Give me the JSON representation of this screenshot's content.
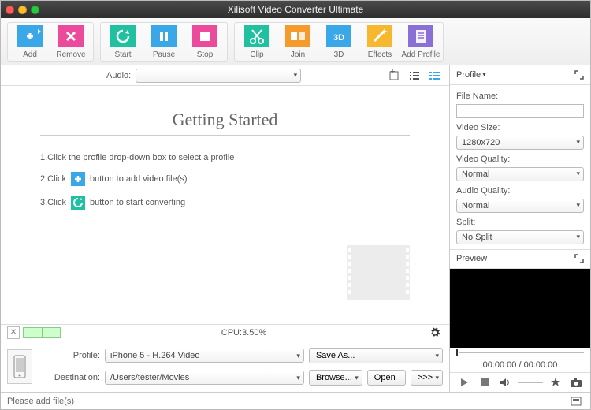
{
  "window": {
    "title": "Xilisoft Video Converter Ultimate"
  },
  "toolbar": {
    "add": "Add",
    "remove": "Remove",
    "start": "Start",
    "pause": "Pause",
    "stop": "Stop",
    "clip": "Clip",
    "join": "Join",
    "threeD": "3D",
    "effects": "Effects",
    "addProfile": "Add Profile"
  },
  "audiobar": {
    "label": "Audio:"
  },
  "getting_started": {
    "title": "Getting Started",
    "step1": "1.Click the profile drop-down box to select a profile",
    "step2_a": "2.Click",
    "step2_b": "button to add video file(s)",
    "step3_a": "3.Click",
    "step3_b": "button to start converting"
  },
  "cpu": {
    "label": "CPU: ",
    "value": "3.50%"
  },
  "dest": {
    "profile_label": "Profile:",
    "profile_value": "iPhone 5 - H.264 Video",
    "dest_label": "Destination:",
    "dest_value": "/Users/tester/Movies",
    "saveas": "Save As...",
    "browse": "Browse...",
    "open": "Open",
    "arrows": ">>>"
  },
  "profile_panel": {
    "title": "Profile",
    "filename_label": "File Name:",
    "filename_value": "",
    "videosize_label": "Video Size:",
    "videosize_value": "1280x720",
    "videoqual_label": "Video Quality:",
    "videoqual_value": "Normal",
    "audioqual_label": "Audio Quality:",
    "audioqual_value": "Normal",
    "split_label": "Split:",
    "split_value": "No Split"
  },
  "preview": {
    "title": "Preview",
    "time": "00:00:00 / 00:00:00"
  },
  "status": {
    "msg": "Please add file(s)"
  },
  "colors": {
    "blue": "#3aa7e8",
    "orange": "#f59b2e",
    "pink": "#ec4a9a",
    "teal": "#1fc1a1",
    "purple": "#8a6fd6",
    "yellow": "#f5b82e"
  }
}
